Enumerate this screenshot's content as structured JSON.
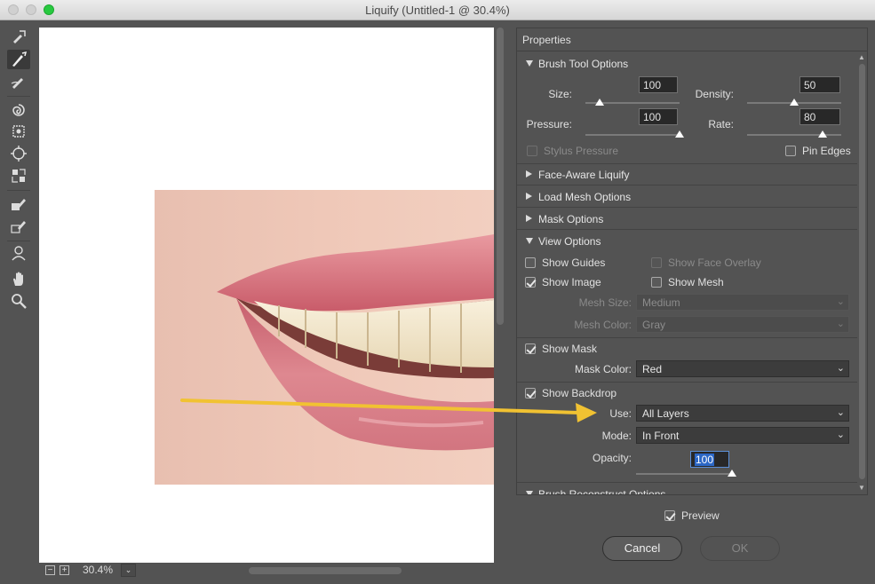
{
  "window": {
    "title": "Liquify (Untitled-1 @ 30.4%)"
  },
  "tools": [
    {
      "name": "forward-warp-tool-icon"
    },
    {
      "name": "reconstruct-tool-icon"
    },
    {
      "name": "smooth-tool-icon"
    },
    {
      "name": "twirl-clockwise-tool-icon"
    },
    {
      "name": "pucker-tool-icon"
    },
    {
      "name": "bloat-tool-icon"
    },
    {
      "name": "push-left-tool-icon"
    },
    {
      "name": "freeze-mask-tool-icon"
    },
    {
      "name": "thaw-mask-tool-icon"
    },
    {
      "name": "face-tool-icon"
    },
    {
      "name": "hand-tool-icon"
    },
    {
      "name": "zoom-tool-icon"
    }
  ],
  "status": {
    "zoom_out": "−",
    "zoom_in": "+",
    "zoom": "30.4%",
    "zoom_dropdown": "⌄"
  },
  "panel": {
    "title": "Properties",
    "brush_tool_options": {
      "title": "Brush Tool Options",
      "size_label": "Size:",
      "size": "100",
      "density_label": "Density:",
      "density": "50",
      "pressure_label": "Pressure:",
      "pressure": "100",
      "rate_label": "Rate:",
      "rate": "80",
      "stylus_pressure": "Stylus Pressure",
      "pin_edges": "Pin Edges",
      "sliders": {
        "size": 0.15,
        "density": 0.5,
        "pressure": 1.0,
        "rate": 0.8
      }
    },
    "face_aware": {
      "title": "Face-Aware Liquify"
    },
    "load_mesh": {
      "title": "Load Mesh Options"
    },
    "mask_options": {
      "title": "Mask Options"
    },
    "view_options": {
      "title": "View Options",
      "show_guides": "Show Guides",
      "show_face_overlay": "Show Face Overlay",
      "show_image": "Show Image",
      "show_mesh": "Show Mesh",
      "mesh_size_label": "Mesh Size:",
      "mesh_size": "Medium",
      "mesh_color_label": "Mesh Color:",
      "mesh_color": "Gray",
      "show_mask": "Show Mask",
      "mask_color_label": "Mask Color:",
      "mask_color": "Red",
      "show_backdrop": "Show Backdrop",
      "use_label": "Use:",
      "use": "All Layers",
      "mode_label": "Mode:",
      "mode": "In Front",
      "opacity_label": "Opacity:",
      "opacity": "100",
      "opacity_slider": 1.0
    },
    "brush_reconstruct": {
      "title": "Brush Reconstruct Options"
    }
  },
  "preview": {
    "label": "Preview"
  },
  "buttons": {
    "cancel": "Cancel",
    "ok": "OK"
  },
  "colors": {
    "annotation_arrow": "#f1c232",
    "panel_bg": "#535353",
    "selection": "#2c67c5"
  }
}
